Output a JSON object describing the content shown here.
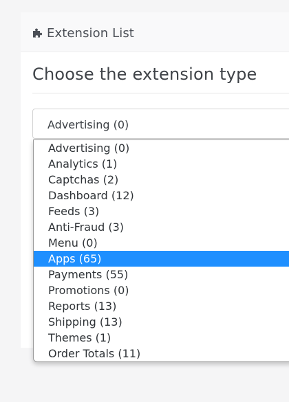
{
  "header": {
    "icon": "puzzle-icon",
    "title": "Extension List"
  },
  "main": {
    "section_title": "Choose the extension type"
  },
  "extension_select": {
    "selected_value": "Advertising (0)",
    "options": [
      "Advertising (0)",
      "Analytics (1)",
      "Captchas (2)",
      "Dashboard (12)",
      "Feeds (3)",
      "Anti-Fraud (3)",
      "Menu (0)",
      "Apps (65)",
      "Payments (55)",
      "Promotions (0)",
      "Reports (13)",
      "Shipping (13)",
      "Themes (1)",
      "Order Totals (11)"
    ],
    "highlighted": "Apps (65)"
  },
  "colors": {
    "highlight": "#1e8fff",
    "page_background": "#f5f5f6",
    "panel_background": "#ffffff"
  }
}
